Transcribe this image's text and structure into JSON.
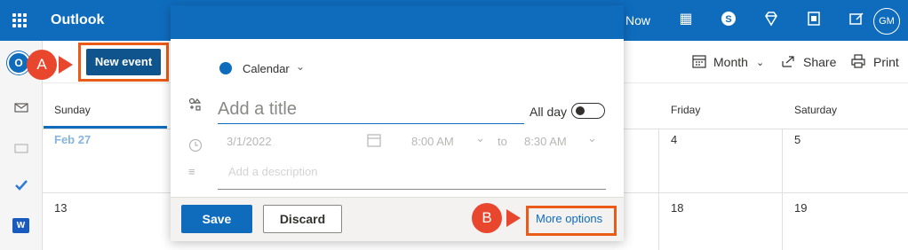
{
  "topbar": {
    "app_title": "Outlook",
    "now_label": "Now",
    "avatar_initials": "GM",
    "icons": [
      "waffle-icon",
      "expand-icon",
      "qr-icon",
      "skype-icon",
      "diamond-icon",
      "office-icon",
      "tasks-icon"
    ]
  },
  "commands": {
    "new_event": "New event",
    "month": "Month",
    "share": "Share",
    "print": "Print"
  },
  "calendar": {
    "day_headers": {
      "sunday": "Sunday",
      "friday": "Friday",
      "saturday": "Saturday"
    },
    "week1": {
      "sunday": "Feb 27",
      "friday": "4",
      "saturday": "5"
    },
    "week2": {
      "sunday": "13",
      "friday": "18",
      "saturday": "19"
    }
  },
  "rail": {
    "word_letter": "W",
    "logo_letter": "O"
  },
  "event_form": {
    "calendar_name": "Calendar",
    "title_placeholder": "Add a title",
    "all_day_label": "All day",
    "date": "3/1/2022",
    "start_time": "8:00 AM",
    "to_label": "to",
    "end_time": "8:30 AM",
    "description_placeholder": "Add a description",
    "save_label": "Save",
    "discard_label": "Discard",
    "more_options_label": "More options"
  },
  "callouts": {
    "a": "A",
    "b": "B"
  },
  "colors": {
    "brand": "#0f6cbd",
    "highlight": "#e95b17",
    "badge": "#e8472d"
  }
}
